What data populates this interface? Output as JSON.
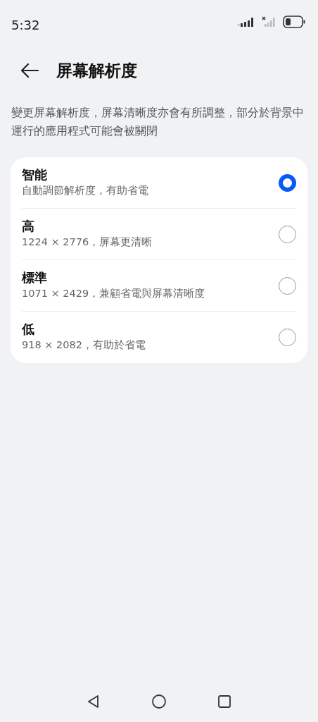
{
  "status_bar": {
    "time": "5:32"
  },
  "header": {
    "title": "屏幕解析度"
  },
  "description": "變更屏幕解析度，屏幕清晰度亦會有所調整，部分於背景中運行的應用程式可能會被關閉",
  "options": [
    {
      "title": "智能",
      "subtitle": "自動調節解析度，有助省電",
      "selected": true
    },
    {
      "title": "高",
      "subtitle": "1224 × 2776，屏幕更清晰",
      "selected": false
    },
    {
      "title": "標準",
      "subtitle": "1071 × 2429，兼顧省電與屏幕清晰度",
      "selected": false
    },
    {
      "title": "低",
      "subtitle": "918 × 2082，有助於省電",
      "selected": false
    }
  ]
}
